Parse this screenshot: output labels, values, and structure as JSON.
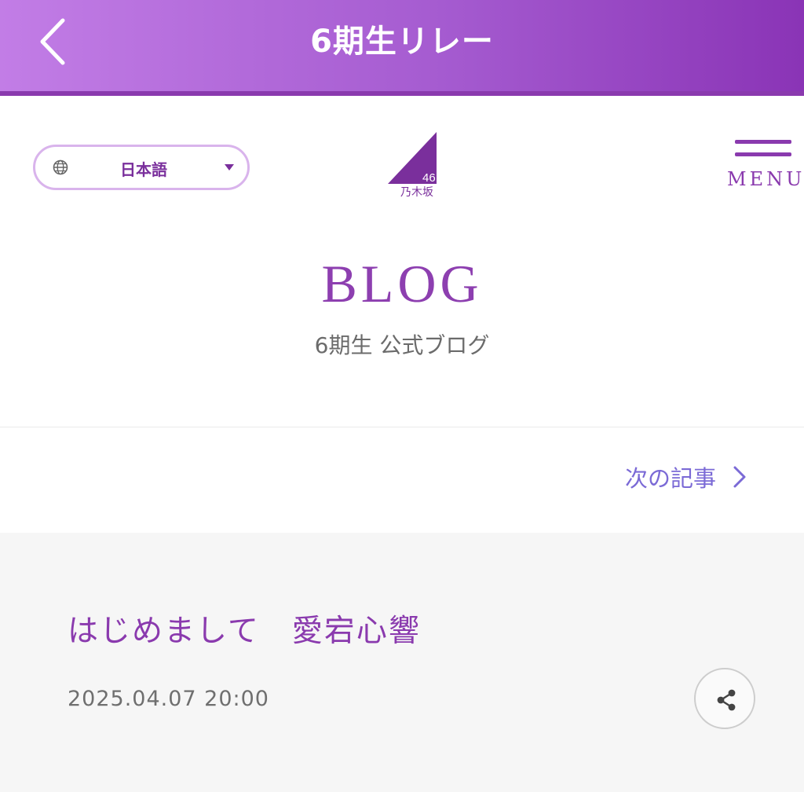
{
  "topbar": {
    "title": "6期生リレー"
  },
  "header": {
    "language": {
      "label": "日本語"
    },
    "logo": {
      "number": "46",
      "name": "乃木坂"
    },
    "menu": {
      "label": "MENU"
    }
  },
  "blog": {
    "title": "BLOG",
    "subtitle": "6期生 公式ブログ"
  },
  "navigation": {
    "next_label": "次の記事"
  },
  "article": {
    "title": "はじめまして　愛宕心響",
    "date": "2025.04.07 20:00"
  },
  "colors": {
    "accent": "#8a3aae",
    "link": "#7b6ad6"
  }
}
